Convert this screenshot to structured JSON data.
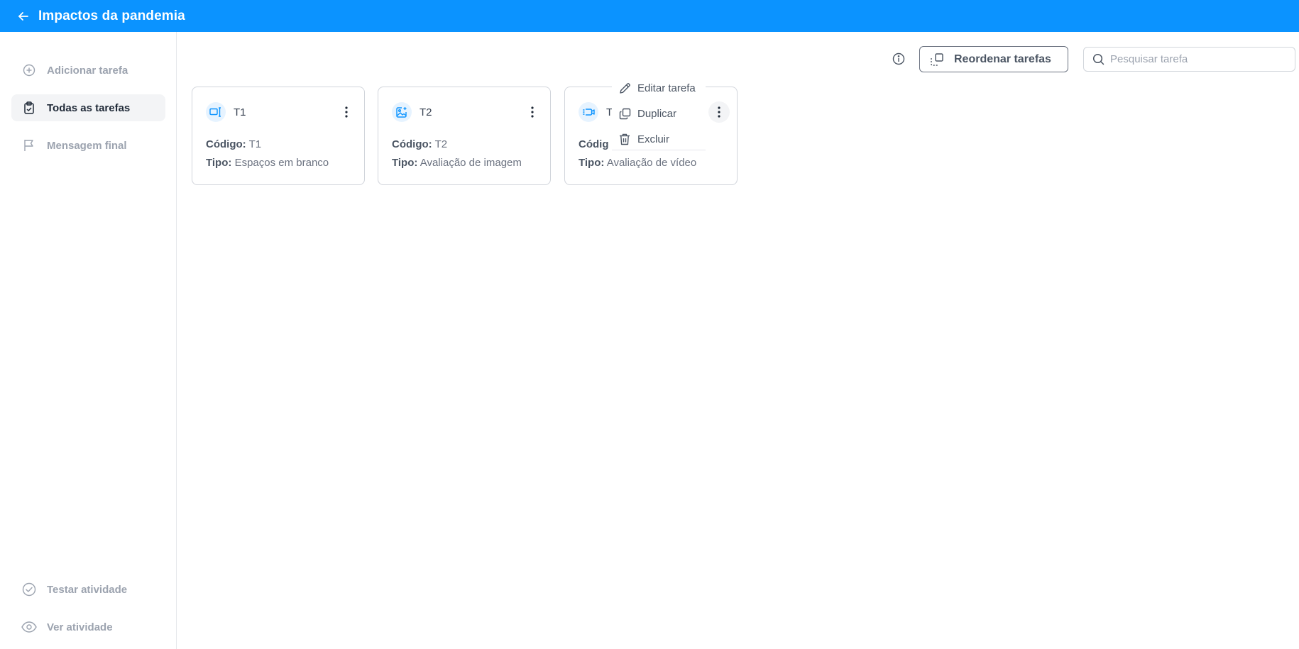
{
  "header": {
    "title": "Impactos da pandemia"
  },
  "sidebar": {
    "items": [
      {
        "label": "Adicionar tarefa"
      },
      {
        "label": "Todas as tarefas"
      },
      {
        "label": "Mensagem final"
      },
      {
        "label": "Testar atividade"
      },
      {
        "label": "Ver atividade"
      }
    ]
  },
  "toolbar": {
    "reorder_label": "Reordenar tarefas",
    "search_placeholder": "Pesquisar tarefa"
  },
  "cards": [
    {
      "name": "T1",
      "code_label": "Código:",
      "code": "T1",
      "type_label": "Tipo:",
      "type": "Espaços em branco",
      "icon": "blank-spaces-icon"
    },
    {
      "name": "T2",
      "code_label": "Código:",
      "code": "T2",
      "type_label": "Tipo:",
      "type": "Avaliação de imagem",
      "icon": "image-evaluation-icon"
    },
    {
      "name": "T",
      "code_label": "Códig",
      "code": "",
      "type_label": "Tipo:",
      "type": "Avaliação de vídeo",
      "icon": "video-evaluation-icon"
    }
  ],
  "context_menu": {
    "items": [
      {
        "label": "Editar tarefa"
      },
      {
        "label": "Duplicar"
      },
      {
        "label": "Excluir"
      }
    ]
  },
  "colors": {
    "brand": "#0b93ff",
    "icon_accent": "#0b93ff"
  }
}
